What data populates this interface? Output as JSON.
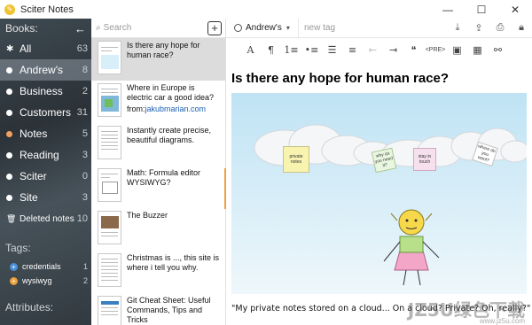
{
  "window": {
    "title": "Sciter Notes",
    "controls": [
      "—",
      "☐",
      "✕"
    ]
  },
  "sidebar": {
    "books_heading": "Books:",
    "back_glyph": "←",
    "books": [
      {
        "label": "All",
        "count": "63",
        "icon": "star-icon",
        "active": false
      },
      {
        "label": "Andrew's",
        "count": "8",
        "icon": "dot",
        "active": true
      },
      {
        "label": "Business",
        "count": "2",
        "icon": "dot"
      },
      {
        "label": "Customers",
        "count": "31",
        "icon": "dot"
      },
      {
        "label": "Notes",
        "count": "5",
        "icon": "dot",
        "color": "#f0a060"
      },
      {
        "label": "Reading",
        "count": "3",
        "icon": "dot"
      },
      {
        "label": "Sciter",
        "count": "0",
        "icon": "dot"
      },
      {
        "label": "Site",
        "count": "3",
        "icon": "dot"
      },
      {
        "label": "Deleted notes",
        "count": "10",
        "icon": "trash-icon"
      }
    ],
    "tags_heading": "Tags:",
    "tags": [
      {
        "label": "credentials",
        "count": "1",
        "color": "#4a90d9"
      },
      {
        "label": "wysiwyg",
        "count": "2",
        "color": "#e8a040"
      }
    ],
    "attributes_heading": "Attributes:"
  },
  "notelist": {
    "search_placeholder": "Search",
    "add_glyph": "+",
    "notes": [
      {
        "title": "Is there any hope for human race?",
        "active": true
      },
      {
        "title": "Where in Europe is electric car a good idea?",
        "from_label": "from:",
        "link": "jakubmarian.com"
      },
      {
        "title": "Instantly create precise, beautiful diagrams."
      },
      {
        "title": "Math: Formula editor WYSIWYG?"
      },
      {
        "title": "The Buzzer"
      },
      {
        "title": "Christmas is ..., this site is where i tell you why."
      },
      {
        "title": "Git Cheat Sheet: Useful Commands, Tips and Tricks"
      }
    ]
  },
  "editor": {
    "book_selected": "Andrew's",
    "tag_placeholder": "new tag",
    "top_icons": [
      "download-icon",
      "export-icon",
      "print-icon",
      "lock-icon"
    ],
    "format_buttons": [
      "A",
      "¶",
      "1≡",
      "•≡",
      "☰",
      "≡",
      "⇤",
      "⇥",
      "❝",
      "<PRE>",
      "▣",
      "▦",
      "⚯"
    ],
    "doc_title": "Is there any hope for human race?",
    "quote": "\"My private notes stored on a cloud... On a cloud? Private? Oh, really?\"",
    "cards": [
      "private notes",
      "why do you need it?",
      "stay in touch",
      "where do you want?"
    ]
  },
  "watermark": {
    "text": "JZ5U绿色下载",
    "url": "www.jz5u.com"
  }
}
